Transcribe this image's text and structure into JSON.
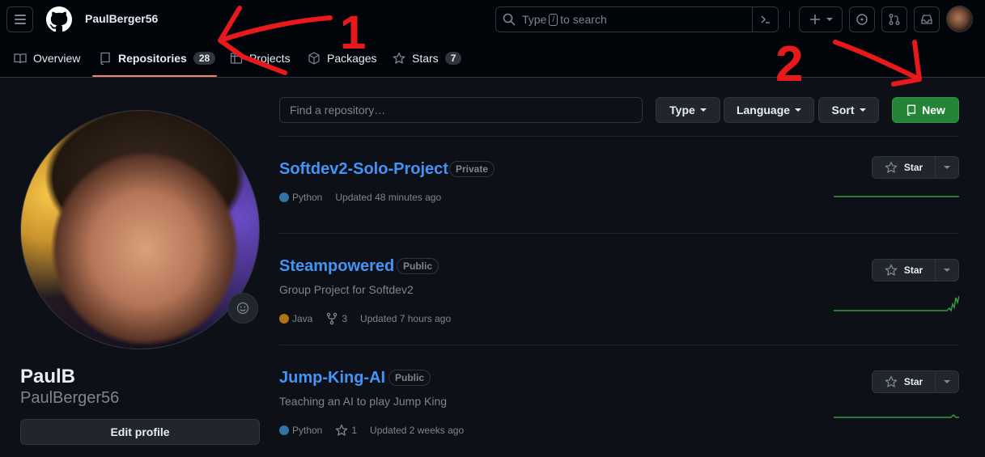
{
  "header": {
    "username": "PaulBerger56",
    "search_prefix": "Type",
    "search_key": "/",
    "search_suffix": "to search"
  },
  "tabs": [
    {
      "label": "Overview",
      "icon": "book-icon"
    },
    {
      "label": "Repositories",
      "count": "28",
      "icon": "repo-icon"
    },
    {
      "label": "Projects",
      "icon": "table-icon"
    },
    {
      "label": "Packages",
      "icon": "package-icon"
    },
    {
      "label": "Stars",
      "count": "7",
      "icon": "star-icon"
    }
  ],
  "profile": {
    "full_name": "PaulB",
    "login": "PaulBerger56",
    "edit_label": "Edit profile"
  },
  "filters": {
    "find_placeholder": "Find a repository…",
    "type_label": "Type",
    "language_label": "Language",
    "sort_label": "Sort",
    "new_label": "New"
  },
  "repos": [
    {
      "name": "Softdev2-Solo-Project",
      "visibility": "Private",
      "description": "",
      "language": "Python",
      "language_color": "#3572A5",
      "forks": "",
      "stars": "",
      "updated": "Updated 48 minutes ago",
      "star_label": "Star"
    },
    {
      "name": "Steampowered",
      "visibility": "Public",
      "description": "Group Project for Softdev2",
      "language": "Java",
      "language_color": "#b07219",
      "forks": "3",
      "stars": "",
      "updated": "Updated 7 hours ago",
      "star_label": "Star"
    },
    {
      "name": "Jump-King-AI",
      "visibility": "Public",
      "description": "Teaching an AI to play Jump King",
      "language": "Python",
      "language_color": "#3572A5",
      "forks": "",
      "stars": "1",
      "updated": "Updated 2 weeks ago",
      "star_label": "Star"
    }
  ],
  "annotations": {
    "label_1": "1",
    "label_2": "2",
    "color": "#e8191b"
  },
  "colors": {
    "accent_link": "#4493f8",
    "primary_button": "#238636",
    "tab_underline": "#f78166",
    "sparkline": "#2ea043"
  }
}
